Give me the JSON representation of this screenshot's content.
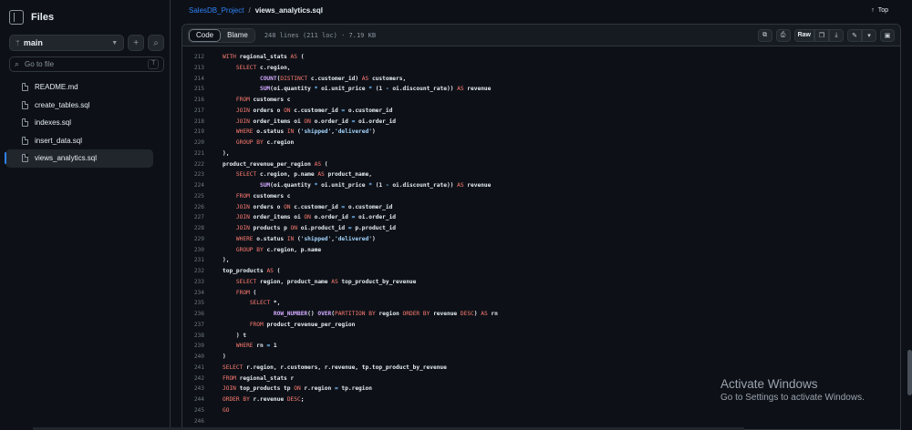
{
  "sidebar": {
    "title": "Files",
    "branch": "main",
    "add_icon": "+",
    "search_icon": "⌕",
    "search_placeholder": "Go to file",
    "search_shortcut": "T",
    "files": [
      {
        "name": "README.md",
        "active": false
      },
      {
        "name": "create_tables.sql",
        "active": false
      },
      {
        "name": "indexes.sql",
        "active": false
      },
      {
        "name": "insert_data.sql",
        "active": false
      },
      {
        "name": "views_analytics.sql",
        "active": true
      }
    ]
  },
  "header": {
    "repo": "SalesDB_Project",
    "separator": "/",
    "file": "views_analytics.sql",
    "top_label": "Top"
  },
  "toolbar": {
    "code_tab": "Code",
    "blame_tab": "Blame",
    "meta": "248 lines (211 loc) · 7.19 KB",
    "raw_label": "Raw"
  },
  "code_lines": [
    {
      "n": 212,
      "t": "WITH regional_stats AS ("
    },
    {
      "n": 213,
      "t": "    SELECT c.region,"
    },
    {
      "n": 214,
      "t": "           COUNT(DISTINCT c.customer_id) AS customers,"
    },
    {
      "n": 215,
      "t": "           SUM(oi.quantity * oi.unit_price * (1 - oi.discount_rate)) AS revenue"
    },
    {
      "n": 216,
      "t": "    FROM customers c"
    },
    {
      "n": 217,
      "t": "    JOIN orders o ON c.customer_id = o.customer_id"
    },
    {
      "n": 218,
      "t": "    JOIN order_items oi ON o.order_id = oi.order_id"
    },
    {
      "n": 219,
      "t": "    WHERE o.status IN ('shipped','delivered')"
    },
    {
      "n": 220,
      "t": "    GROUP BY c.region"
    },
    {
      "n": 221,
      "t": "),"
    },
    {
      "n": 222,
      "t": "product_revenue_per_region AS ("
    },
    {
      "n": 223,
      "t": "    SELECT c.region, p.name AS product_name,"
    },
    {
      "n": 224,
      "t": "           SUM(oi.quantity * oi.unit_price * (1 - oi.discount_rate)) AS revenue"
    },
    {
      "n": 225,
      "t": "    FROM customers c"
    },
    {
      "n": 226,
      "t": "    JOIN orders o ON c.customer_id = o.customer_id"
    },
    {
      "n": 227,
      "t": "    JOIN order_items oi ON o.order_id = oi.order_id"
    },
    {
      "n": 228,
      "t": "    JOIN products p ON oi.product_id = p.product_id"
    },
    {
      "n": 229,
      "t": "    WHERE o.status IN ('shipped','delivered')"
    },
    {
      "n": 230,
      "t": "    GROUP BY c.region, p.name"
    },
    {
      "n": 231,
      "t": "),"
    },
    {
      "n": 232,
      "t": "top_products AS ("
    },
    {
      "n": 233,
      "t": "    SELECT region, product_name AS top_product_by_revenue"
    },
    {
      "n": 234,
      "t": "    FROM ("
    },
    {
      "n": 235,
      "t": "        SELECT *,"
    },
    {
      "n": 236,
      "t": "               ROW_NUMBER() OVER(PARTITION BY region ORDER BY revenue DESC) AS rn"
    },
    {
      "n": 237,
      "t": "        FROM product_revenue_per_region"
    },
    {
      "n": 238,
      "t": "    ) t"
    },
    {
      "n": 239,
      "t": "    WHERE rn = 1"
    },
    {
      "n": 240,
      "t": ")"
    },
    {
      "n": 241,
      "t": "SELECT r.region, r.customers, r.revenue, tp.top_product_by_revenue"
    },
    {
      "n": 242,
      "t": "FROM regional_stats r"
    },
    {
      "n": 243,
      "t": "JOIN top_products tp ON r.region = tp.region"
    },
    {
      "n": 244,
      "t": "ORDER BY r.revenue DESC;"
    },
    {
      "n": 245,
      "t": "GO"
    },
    {
      "n": 246,
      "t": ""
    }
  ],
  "watermark": {
    "line1": "Activate Windows",
    "line2": "Go to Settings to activate Windows."
  },
  "colors": {
    "background": "#0d1117",
    "accent": "#2f81f7",
    "keyword": "#ff7b72",
    "function": "#d2a8ff"
  }
}
